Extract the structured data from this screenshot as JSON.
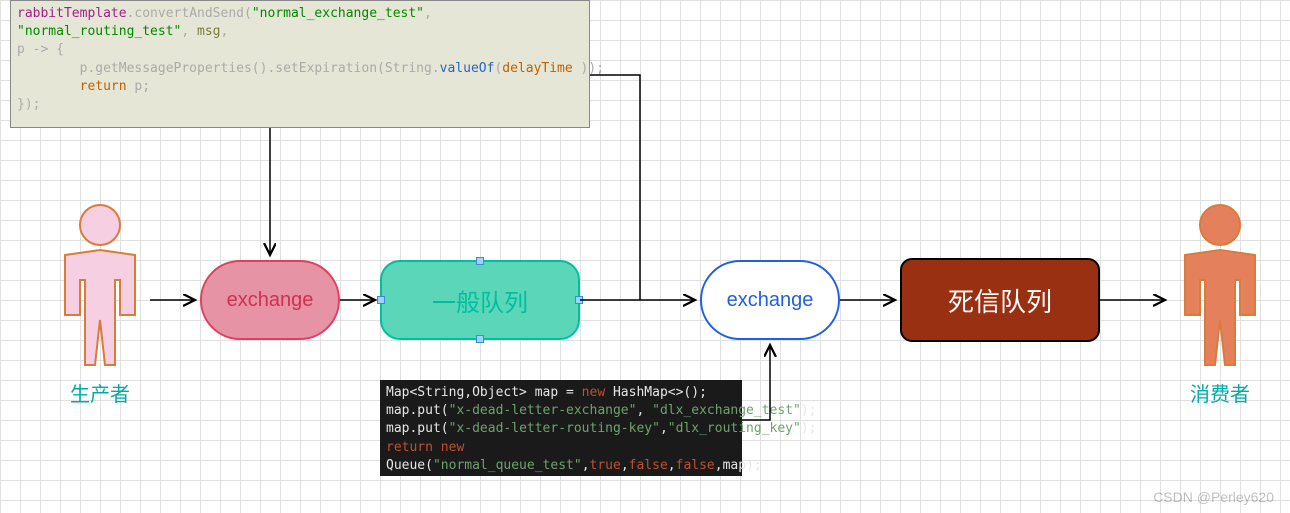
{
  "producer": {
    "label": "生产者"
  },
  "consumer": {
    "label": "消费者"
  },
  "nodes": {
    "exchange1": "exchange",
    "queueNormal": "一般队列",
    "exchange2": "exchange",
    "queueDlx": "死信队列"
  },
  "codeTop": {
    "t1a": "rabbitTemplate",
    "t1b": ".convertAndSend(",
    "t1c": "\"normal_exchange_test\"",
    "t1d": ",",
    "t2a": "\"normal_routing_test\"",
    "t2b": ", ",
    "t2c": "msg",
    "t2d": ",",
    "t3": "p -> {",
    "t4a": "        p.getMessageProperties().setExpiration(String.",
    "t4b": "valueOf",
    "t4c": "(",
    "t4d": "delayTime ",
    "t4e": "));",
    "t5a": "        return",
    "t5b": " p;",
    "t6": "});"
  },
  "codeBottom": {
    "b1a": "Map<String,Object> map = ",
    "b1b": "new ",
    "b1c": "HashMap<>();",
    "b2a": "map.put(",
    "b2b": "\"x-dead-letter-exchange\"",
    "b2c": ", ",
    "b2d": "\"dlx_exchange_test\"",
    "b2e": ");",
    "b3a": "map.put(",
    "b3b": "\"x-dead-letter-routing-key\"",
    "b3c": ",",
    "b3d": "\"dlx_routing_key\"",
    "b3e": ");",
    "b4a": "return ",
    "b4b": "new",
    "b5a": "Queue(",
    "b5b": "\"normal_queue_test\"",
    "b5c": ",",
    "b5d": "true",
    "b5e": ",",
    "b5f": "false",
    "b5g": ",",
    "b5h": "false",
    "b5i": ",map);"
  },
  "watermark": "CSDN @Perley620"
}
